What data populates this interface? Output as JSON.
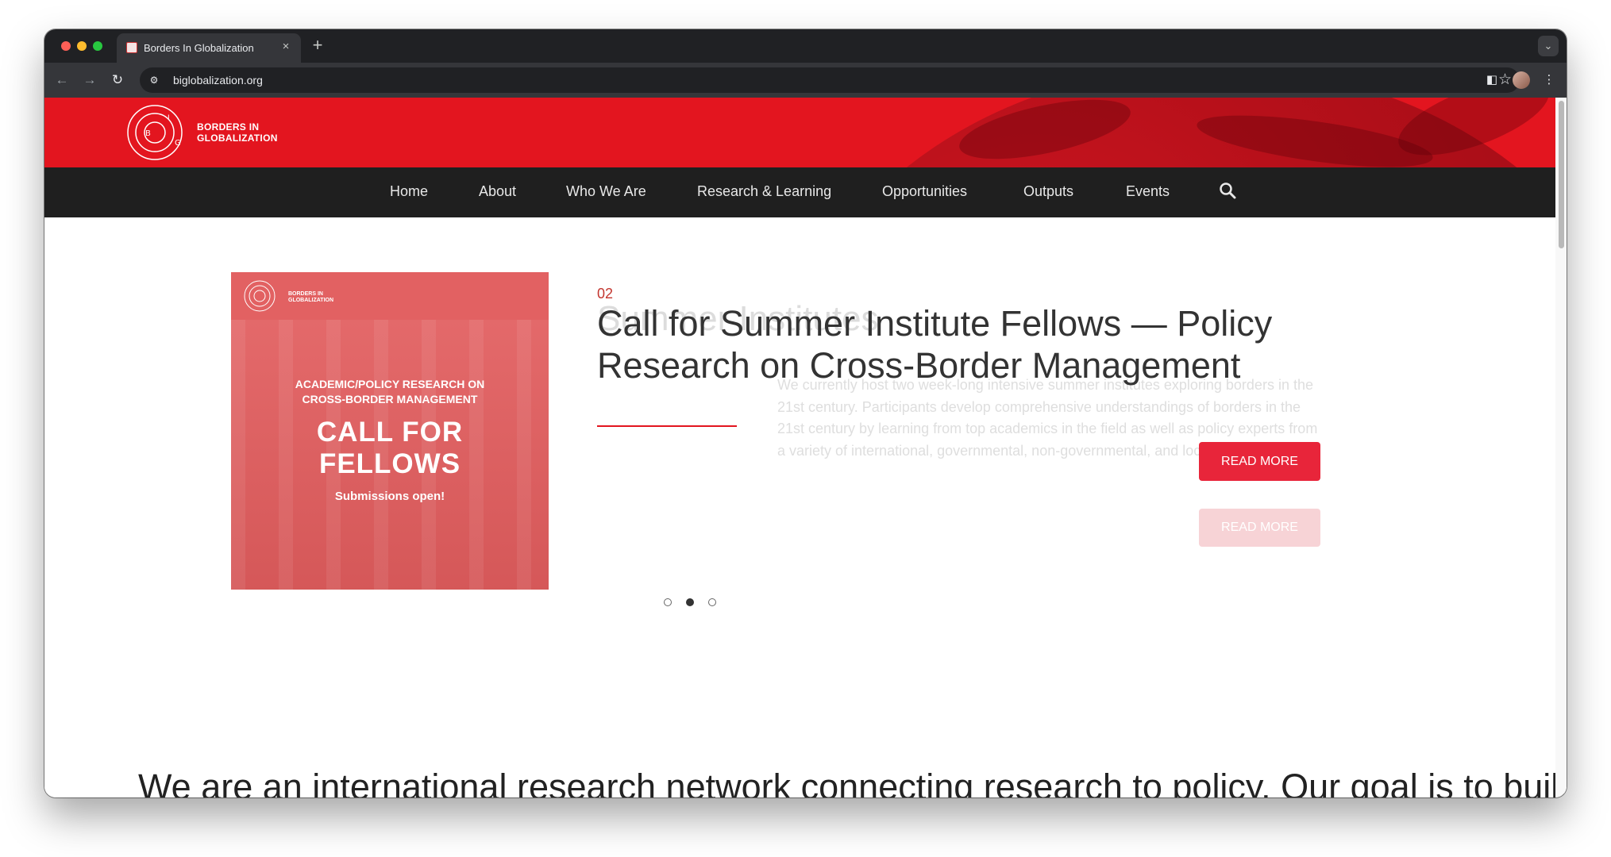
{
  "browser": {
    "tab_title": "Borders In Globalization",
    "url": "biglobalization.org",
    "tab_close_glyph": "×",
    "new_tab_glyph": "+",
    "icons": [
      "back-icon",
      "forward-icon",
      "reload-icon",
      "site-info-icon",
      "bookmark-star-icon",
      "side-panel-icon",
      "profile-avatar",
      "kebab-menu-icon",
      "tab-search-icon"
    ]
  },
  "site": {
    "logo_text_line1": "BORDERS IN",
    "logo_text_line2": "GLOBALIZATION",
    "logo_letters": [
      "B",
      "I",
      "G"
    ],
    "nav": [
      {
        "label": "Home"
      },
      {
        "label": "About"
      },
      {
        "label": "Who We Are"
      },
      {
        "label": "Research & Learning"
      },
      {
        "label": "Opportunities"
      },
      {
        "label": "Outputs"
      },
      {
        "label": "Events"
      }
    ],
    "search_icon": "search-icon"
  },
  "slider": {
    "image": {
      "logo_text_line1": "BORDERS IN",
      "logo_text_line2": "GLOBALIZATION",
      "subtitle_line1": "ACADEMIC/POLICY RESEARCH ON",
      "subtitle_line2": "CROSS-BORDER MANAGEMENT",
      "headline_line1": "CALL FOR",
      "headline_line2": "FELLOWS",
      "tagline": "Submissions open!"
    },
    "ghost_prev": {
      "title": "Summer Institutes",
      "description": "We currently host two week-long intensive summer institutes exploring borders in the 21st century. Participants develop comprehensive understandings of borders in the 21st century by learning from top academics in the field as well as policy experts from a variety of international, governmental, non-governmental, and local organizations.",
      "button": "READ MORE"
    },
    "current": {
      "number": "02",
      "title": "Call for Summer Institute Fellows — Policy Research on Cross-Border Management",
      "button": "READ MORE"
    },
    "dots_total": 3,
    "active_dot": 2
  },
  "mission_text": "We are an international research network connecting research to policy. Our goal is to build",
  "colors": {
    "brand_red": "#e3151f",
    "nav_bg": "#1f1f1f",
    "button_red": "#e8253a",
    "slide_image_bg": "#e26162"
  }
}
